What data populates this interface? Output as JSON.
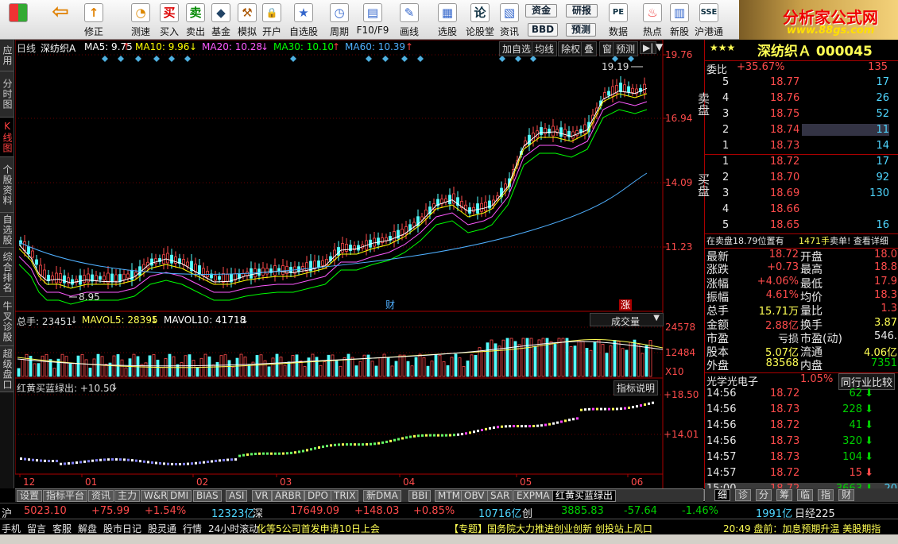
{
  "toolbar": {
    "items": [
      {
        "label": "",
        "icon": "window-grid-icon"
      },
      {
        "label": "",
        "icon": "back-arrow-icon"
      },
      {
        "label": "修正",
        "icon": "correct-icon"
      },
      {
        "label": "测速",
        "icon": "speed-test-icon"
      },
      {
        "label": "买入",
        "icon": "buy-icon",
        "glyph": "买"
      },
      {
        "label": "卖出",
        "icon": "sell-icon",
        "glyph": "卖"
      },
      {
        "label": "基金",
        "icon": "fund-icon"
      },
      {
        "label": "模拟",
        "icon": "simulate-icon"
      },
      {
        "label": "开户",
        "icon": "lock-icon"
      },
      {
        "label": "自选股",
        "icon": "star-folder-icon"
      },
      {
        "label": "周期",
        "icon": "clock-period-icon"
      },
      {
        "label": "F10/F9",
        "icon": "f10-icon"
      },
      {
        "label": "画线",
        "icon": "pencil-icon"
      },
      {
        "label": "选股",
        "icon": "stock-screen-icon"
      },
      {
        "label": "论股堂",
        "icon": "forum-icon",
        "glyph": "论"
      },
      {
        "label": "资讯",
        "icon": "info-icon"
      },
      {
        "label": "资金",
        "icon": "capital-icon"
      },
      {
        "label": "研报",
        "icon": "report-icon"
      },
      {
        "label": "BBD",
        "icon": "bbd-icon"
      },
      {
        "label": "预测",
        "icon": "forecast-icon"
      },
      {
        "label": "数据",
        "icon": "pe-data-icon",
        "glyph": "PE"
      },
      {
        "label": "热点",
        "icon": "hot-icon"
      },
      {
        "label": "新股",
        "icon": "new-stock-icon"
      },
      {
        "label": "沪港通",
        "icon": "hk-connect-icon",
        "glyph": "SSE"
      }
    ],
    "logo_text": "分析家公式网",
    "logo_url": "www.88gs.com"
  },
  "sidetabs": [
    "应用",
    "分时图",
    "K线图",
    "个股资料",
    "自选股",
    "综合排名",
    "牛叉诊股",
    "超级盘口"
  ],
  "main_panel": {
    "period": "日线",
    "stock": "深纺织A",
    "ma": [
      {
        "label": "MA5: 9.75",
        "arrow": "↑",
        "color": "#ffffff"
      },
      {
        "label": "MA10: 9.96",
        "arrow": "↓",
        "color": "#ffff00"
      },
      {
        "label": "MA20: 10.28",
        "arrow": "↓",
        "color": "#ff5aff"
      },
      {
        "label": "MA30: 10.10",
        "arrow": "↑",
        "color": "#00ff00"
      },
      {
        "label": "MA60: 10.39",
        "arrow": "↑",
        "color": "#4fb0ff"
      }
    ],
    "buttons": [
      "加自选",
      "均线",
      "除权",
      "叠",
      "窗",
      "预测"
    ],
    "price_ticks": [
      "19.76",
      "16.94",
      "14.09",
      "11.23"
    ],
    "high_label": "19.19",
    "low_label": "8.95",
    "markers": [
      "财",
      "涨"
    ]
  },
  "volume_panel": {
    "title": "总手: 23451",
    "mavol5": "MAVOL5: 28395",
    "mavol10": "MAVOL10: 41718",
    "dropdown": "成交量",
    "ticks": [
      "24578",
      "12484",
      "X10"
    ]
  },
  "indicator_panel": {
    "title": "红黄买蓝绿出: +10.50",
    "help_button": "指标说明",
    "ticks": [
      "+18.50",
      "+14.01"
    ]
  },
  "x_axis": [
    "12",
    "01",
    "02",
    "03",
    "04",
    "05",
    "06"
  ],
  "bottom_tabs": [
    "设置",
    "指标平台",
    "资讯",
    "主力",
    "W&R",
    "DMI",
    "BIAS",
    "ASI",
    "VR",
    "ARBR",
    "DPO",
    "TRIX",
    "新DMA",
    "BBI",
    "MTM",
    "OBV",
    "SAR",
    "EXPMA",
    "红黄买蓝绿出"
  ],
  "info": {
    "title": "深纺织Ａ 000045",
    "ratio_label": "委比",
    "ratio_value": "+35.67%",
    "ratio_diff": "135",
    "sell_label": "卖盘",
    "buy_label": "买盘",
    "sell": [
      {
        "n": "5",
        "p": "18.77",
        "v": "17"
      },
      {
        "n": "4",
        "p": "18.76",
        "v": "26"
      },
      {
        "n": "3",
        "p": "18.75",
        "v": "52"
      },
      {
        "n": "2",
        "p": "18.74",
        "v": "11"
      },
      {
        "n": "1",
        "p": "18.73",
        "v": "14"
      }
    ],
    "buy": [
      {
        "n": "1",
        "p": "18.72",
        "v": "17"
      },
      {
        "n": "2",
        "p": "18.70",
        "v": "92"
      },
      {
        "n": "3",
        "p": "18.69",
        "v": "130"
      },
      {
        "n": "4",
        "p": "18.66",
        "v": ""
      },
      {
        "n": "5",
        "p": "18.65",
        "v": "16"
      }
    ],
    "notice1": "在卖盘18.79位置有",
    "notice2": "1471手",
    "notice3": "卖单! 查看详细",
    "stats": [
      {
        "l": "最新",
        "v": "18.72",
        "l2": "开盘",
        "v2": "18.0"
      },
      {
        "l": "涨跌",
        "v": "+0.73",
        "l2": "最高",
        "v2": "18.8"
      },
      {
        "l": "涨幅",
        "v": "+4.06%",
        "l2": "最低",
        "v2": "17.9"
      },
      {
        "l": "振幅",
        "v": "4.61%",
        "l2": "均价",
        "v2": "18.3"
      },
      {
        "l": "总手",
        "v": "15.71万",
        "l2": "量比",
        "v2": "1.3"
      },
      {
        "l": "金额",
        "v": "2.88亿",
        "l2": "换手",
        "v2": "3.87"
      },
      {
        "l": "市盈",
        "v": "亏损",
        "l2": "市盈(动)",
        "v2": "546."
      },
      {
        "l": "股本",
        "v": "5.07亿",
        "l2": "流通",
        "v2": "4.06亿"
      },
      {
        "l": "外盘",
        "v": "83568",
        "l2": "内盘",
        "v2": "7351"
      }
    ],
    "sector": "光学光电子",
    "sector_pct": "1.05%",
    "compare_button": "同行业比较",
    "ticks": [
      {
        "t": "14:56",
        "p": "18.72",
        "v": "62",
        "d": "down"
      },
      {
        "t": "14:56",
        "p": "18.73",
        "v": "228",
        "d": "down"
      },
      {
        "t": "14:56",
        "p": "18.72",
        "v": "41",
        "d": "down"
      },
      {
        "t": "14:56",
        "p": "18.73",
        "v": "320",
        "d": "down"
      },
      {
        "t": "14:57",
        "p": "18.73",
        "v": "104",
        "d": "down"
      },
      {
        "t": "14:57",
        "p": "18.72",
        "v": "15",
        "d": "up"
      },
      {
        "t": "15:00",
        "p": "18.72",
        "v": "3663",
        "d": "down",
        "extra": "20"
      }
    ],
    "tabs": [
      "细",
      "诊",
      "分",
      "筹",
      "临",
      "指",
      "财"
    ]
  },
  "index_bar": {
    "sh_label": "沪",
    "sh_val": "5023.10",
    "sh_chg": "+75.99",
    "sh_pct": "+1.54%",
    "sh_amt": "12323亿",
    "sz_label": "深",
    "sz_val": "17649.09",
    "sz_chg": "+148.03",
    "sz_pct": "+0.85%",
    "sz_amt": "10716亿",
    "cy_label": "创",
    "cy_val": "3885.83",
    "cy_chg": "-57.64",
    "cy_pct": "-1.46%",
    "cy_amt": "1991亿",
    "extra": "日经225"
  },
  "status_bar": {
    "items": [
      "手机",
      "留言",
      "客服",
      "解盘",
      "股市日记",
      "股灵通",
      "行情",
      "24小时滚动"
    ],
    "news1": "化等5公司首发申请10日上会",
    "news2": "【专题】国务院大力推进创业创新 创投站上风口",
    "news3": "20:49 盘前：加息预期升温 美股期指"
  }
}
